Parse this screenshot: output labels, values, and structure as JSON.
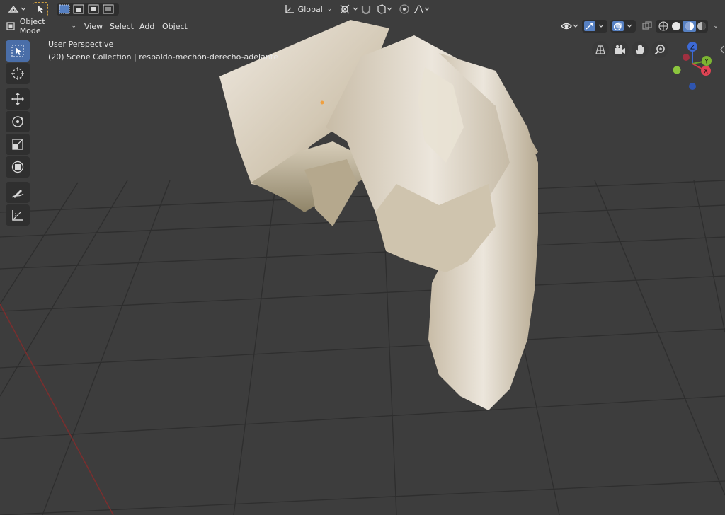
{
  "header": {
    "transform_orientation": "Global",
    "mode": "Object Mode",
    "menus": [
      "View",
      "Select",
      "Add",
      "Object"
    ]
  },
  "overlay_text": {
    "perspective": "User Perspective",
    "collection": "(20) Scene Collection | respaldo-mechón-derecho-adelante"
  },
  "gizmo": {
    "z": "Z",
    "y": "Y",
    "x": "X"
  },
  "colors": {
    "viewport_bg": "#3d3d3d",
    "grid": "#2f2f2f",
    "x_axis": "#8a3030",
    "active_blue": "#5680c2",
    "mesh": "#d8d0c0"
  },
  "icons": {
    "toolbar": [
      "select-box-icon",
      "cursor-icon",
      "move-icon",
      "rotate-icon",
      "scale-icon",
      "transform-icon",
      "annotate-icon",
      "measure-icon"
    ],
    "navigation": [
      "orthographic-grid-icon",
      "camera-icon",
      "hand-pan-icon",
      "zoom-icon"
    ]
  }
}
